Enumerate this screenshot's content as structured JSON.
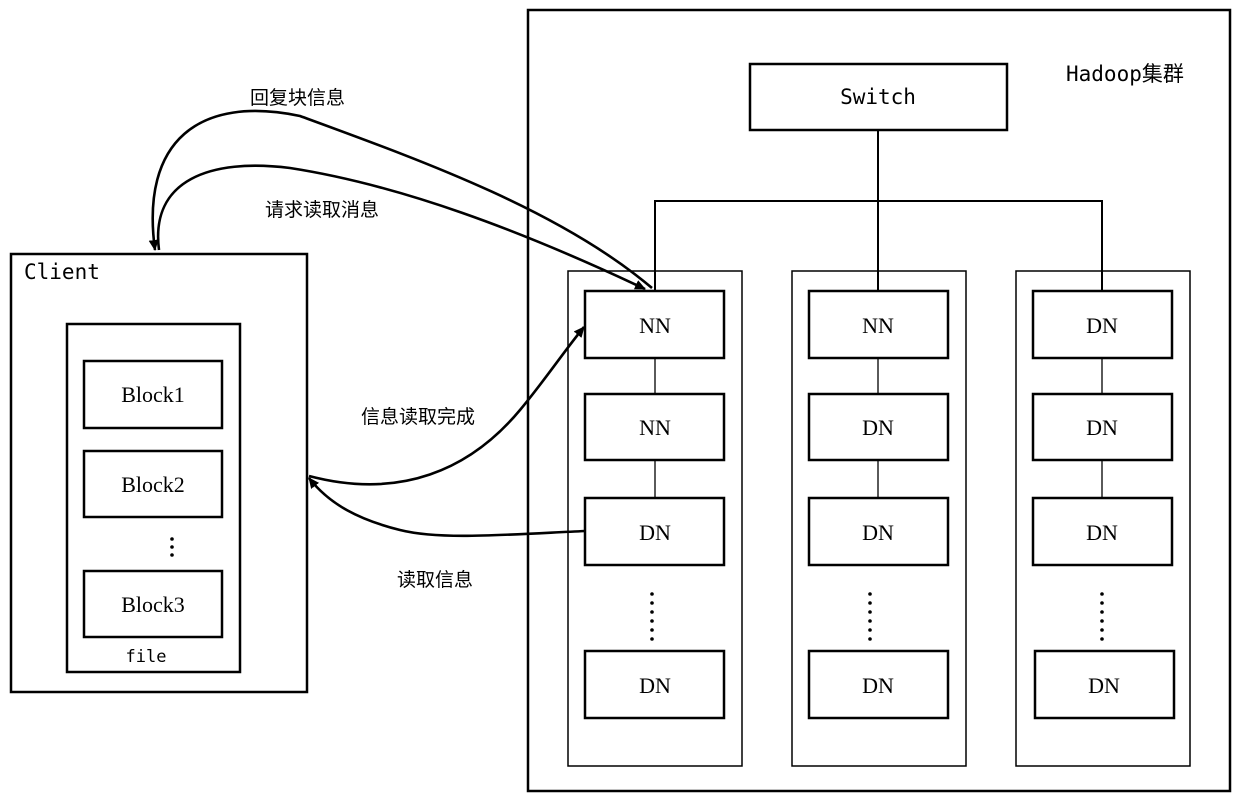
{
  "cluster": {
    "title": "Hadoop集群",
    "switch_label": "Switch",
    "racks": [
      {
        "nodes": [
          "NN",
          "NN",
          "DN",
          "DN"
        ]
      },
      {
        "nodes": [
          "NN",
          "DN",
          "DN",
          "DN"
        ]
      },
      {
        "nodes": [
          "DN",
          "DN",
          "DN",
          "DN"
        ]
      }
    ]
  },
  "client": {
    "title": "Client",
    "file_label": "file",
    "blocks": [
      "Block1",
      "Block2",
      "Block3"
    ],
    "ellipsis": "⋮"
  },
  "messages": {
    "reply_block_info": "回复块信息",
    "request_read": "请求读取消息",
    "read_complete": "信息读取完成",
    "read_info": "读取信息"
  }
}
